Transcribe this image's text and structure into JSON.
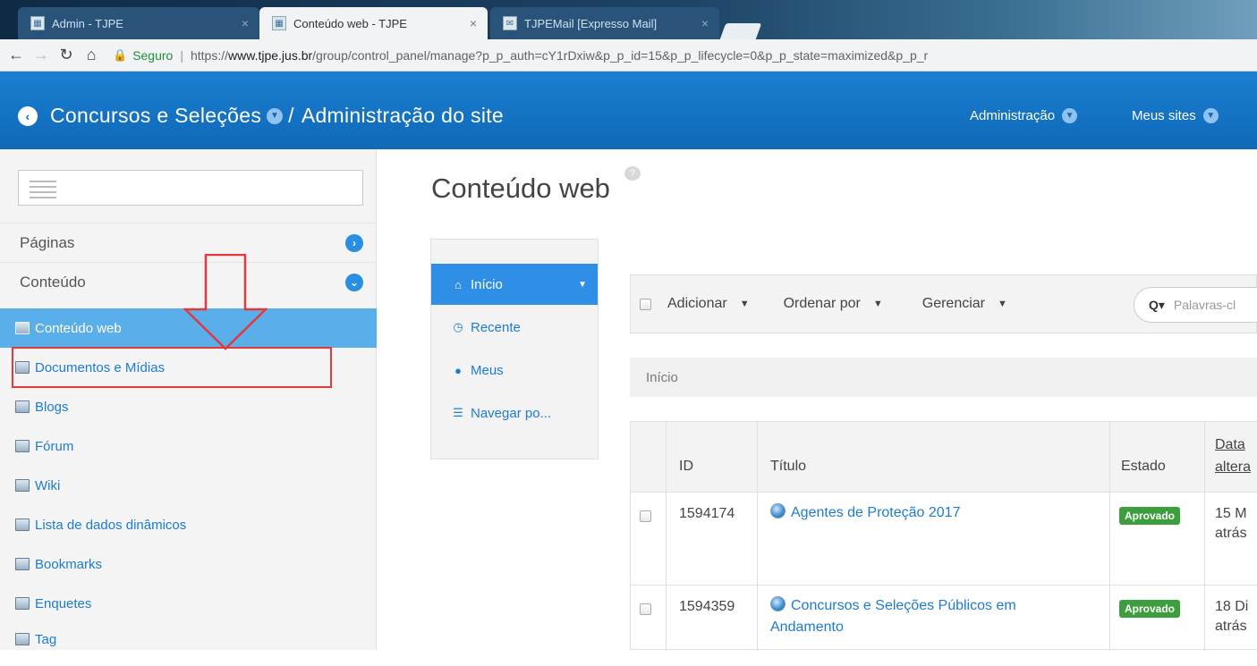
{
  "browser": {
    "tabs": [
      {
        "title": "Admin - TJPE",
        "close": "×"
      },
      {
        "title": "Conteúdo web - TJPE",
        "close": "×"
      },
      {
        "title": "TJPEMail [Expresso Mail]",
        "close": "×"
      }
    ],
    "secure_label": "Seguro",
    "url_scheme": "https://",
    "url_host": "www.tjpe.jus.br",
    "url_path": "/group/control_panel/manage?p_p_auth=cY1rDxiw&p_p_id=15&p_p_lifecycle=0&p_p_state=maximized&p_p_r"
  },
  "header": {
    "site_name": "Concursos e Seleções",
    "separator": "/",
    "section": "Administração do site",
    "menu_admin": "Administração",
    "menu_sites": "Meus sites"
  },
  "sidebar": {
    "panels": [
      {
        "label": "Páginas",
        "toggle": "›"
      },
      {
        "label": "Conteúdo",
        "toggle": "⌄"
      }
    ],
    "items": [
      {
        "label": "Conteúdo web"
      },
      {
        "label": "Documentos e Mídias"
      },
      {
        "label": "Blogs"
      },
      {
        "label": "Fórum"
      },
      {
        "label": "Wiki"
      },
      {
        "label": "Lista de dados dinâmicos"
      },
      {
        "label": "Bookmarks"
      },
      {
        "label": "Enquetes"
      },
      {
        "label": "Tag"
      }
    ]
  },
  "main": {
    "title": "Conteúdo web",
    "leftnav": [
      {
        "label": "Início",
        "icon": "⌂"
      },
      {
        "label": "Recente",
        "icon": "◷"
      },
      {
        "label": "Meus",
        "icon": "●"
      },
      {
        "label": "Navegar po...",
        "icon": "☰"
      }
    ],
    "toolbar": {
      "add": "Adicionar",
      "order": "Ordenar por",
      "manage": "Gerenciar",
      "search_placeholder": "Palavras-cl"
    },
    "breadcrumb": "Início",
    "table": {
      "headers": {
        "id": "ID",
        "title": "Título",
        "state": "Estado",
        "date_line1": "Data",
        "date_line2": "altera"
      },
      "rows": [
        {
          "id": "1594174",
          "title": "Agentes de Proteção 2017",
          "state": "Aprovado",
          "date_line1": "15 M",
          "date_line2": "atrás"
        },
        {
          "id": "1594359",
          "title_line1": "Concursos e Seleções Públicos em",
          "title_line2": "Andamento",
          "state": "Aprovado",
          "date_line1": "18 Di",
          "date_line2": "atrás"
        }
      ]
    }
  },
  "colors": {
    "header_blue": "#0f69b8",
    "active_nav": "#5aaeea",
    "link": "#1d7bd0",
    "badge_green": "#3d9e3d",
    "highlight_red": "#e23a3a"
  }
}
